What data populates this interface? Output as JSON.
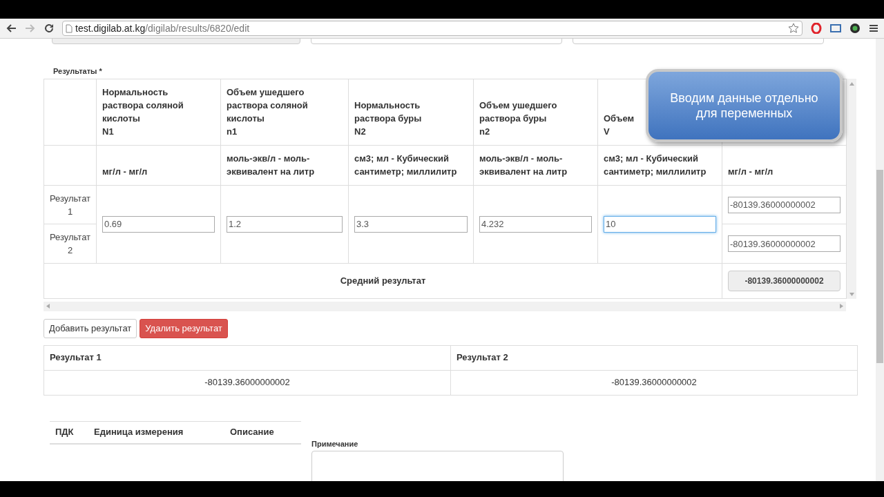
{
  "browser": {
    "url_host": "test.digilab.at.kg",
    "url_path": "/digilab/results/6820/edit"
  },
  "section_label": "Результаты *",
  "callout": "Вводим данные отдельно для переменных",
  "table": {
    "columns": [
      {
        "title": "Нормальность раствора соляной кислоты",
        "symbol": "N1",
        "unit": "мг/л - мг/л",
        "value": "0.69",
        "focused": false
      },
      {
        "title": "Объем ушедшего раствора соляной кислоты",
        "symbol": "n1",
        "unit": "моль-экв/л - моль-эквивалент на литр",
        "value": "1.2",
        "focused": false
      },
      {
        "title": "Нормальность раствора буры",
        "symbol": "N2",
        "unit": "см3; мл - Кубический сантиметр; миллилитр",
        "value": "3.3",
        "focused": false
      },
      {
        "title": "Объем ушедшего раствора буры",
        "symbol": "n2",
        "unit": "моль-экв/л - моль-эквивалент на литр",
        "value": "4.232",
        "focused": false
      },
      {
        "title": "Объем",
        "symbol": "V",
        "unit": "см3; мл - Кубический сантиметр; миллилитр",
        "value": "10",
        "focused": true
      }
    ],
    "result_unit": "мг/л - мг/л",
    "rows": [
      {
        "label": "Результат 1",
        "result": "-80139.36000000002"
      },
      {
        "label": "Результат 2",
        "result": "-80139.36000000002"
      }
    ],
    "average_label": "Средний результат",
    "average_value": "-80139.36000000002"
  },
  "buttons": [
    {
      "label": "Добавить результат",
      "kind": "default"
    },
    {
      "label": "Удалить результат",
      "kind": "danger"
    }
  ],
  "summary": {
    "columns": [
      "Результат 1",
      "Результат 2"
    ],
    "values": [
      "-80139.36000000002",
      "-80139.36000000002"
    ]
  },
  "norms_table": {
    "columns": [
      "ПДК",
      "Единица измерения",
      "Описание"
    ]
  },
  "note_label": "Примечание"
}
